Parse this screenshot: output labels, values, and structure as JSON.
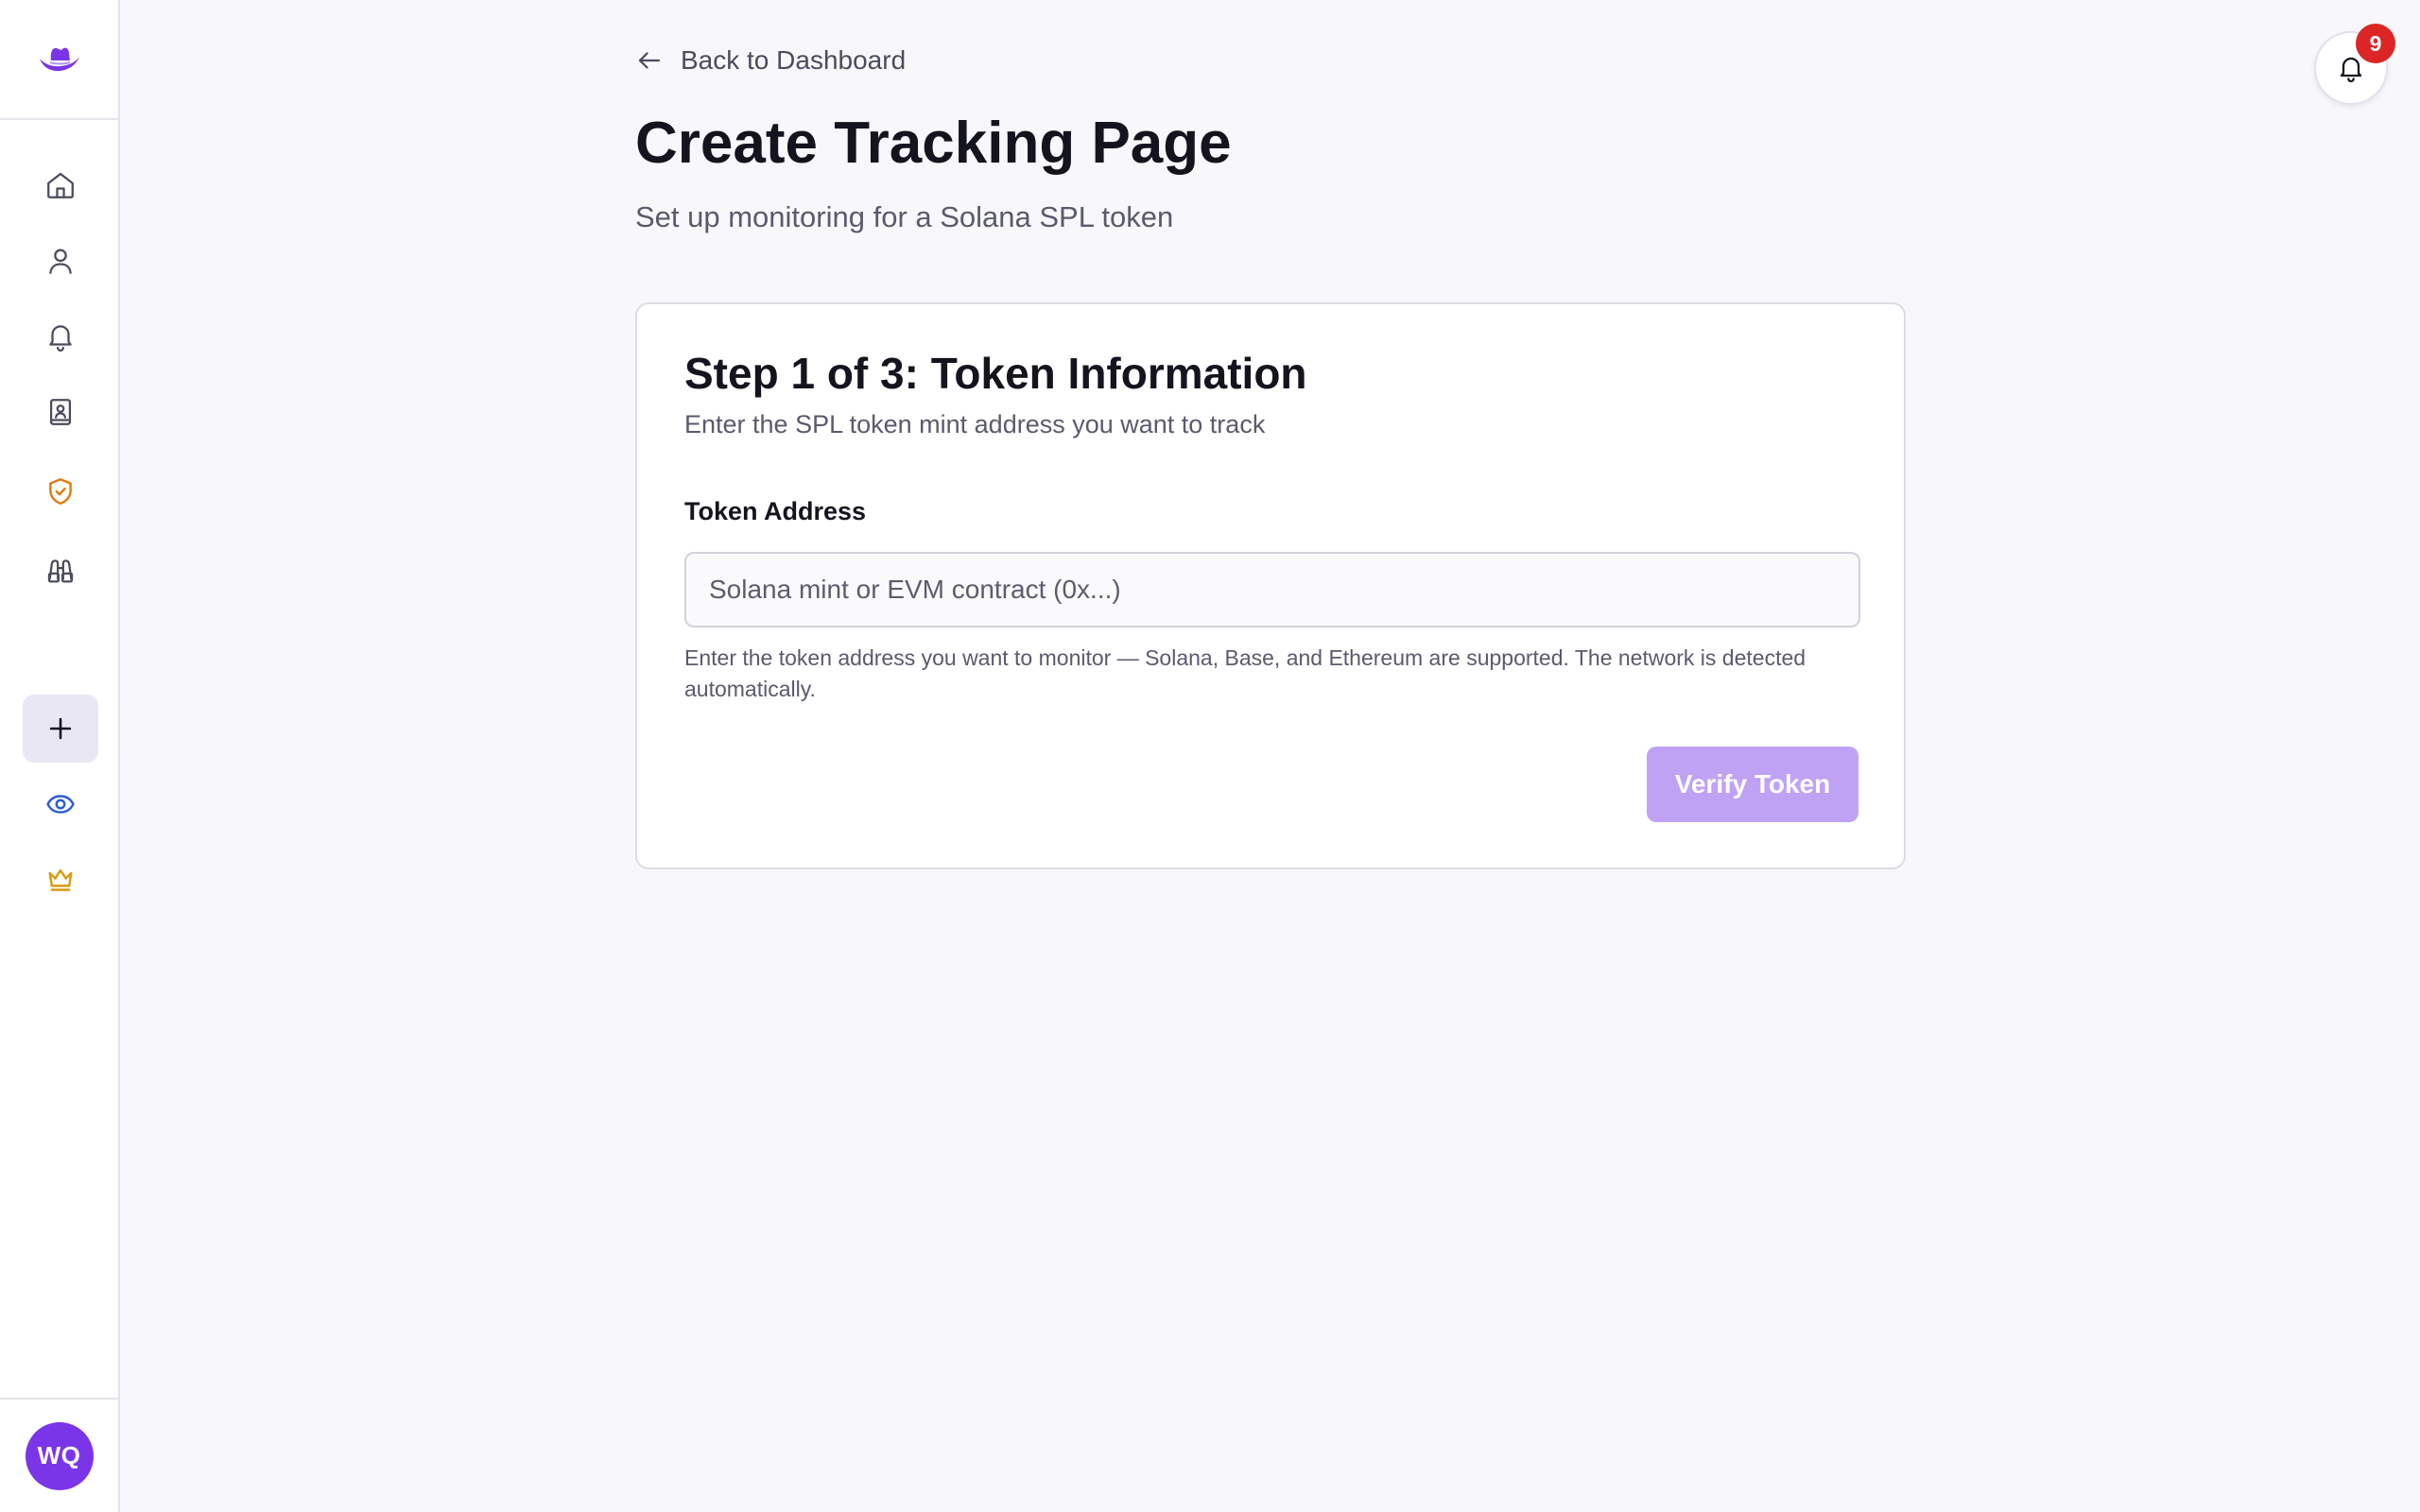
{
  "colors": {
    "accent": "#7b35e8",
    "button_disabled": "#c0a2f5",
    "badge": "#dc2626",
    "shield": "#e07a10",
    "eye": "#2b5bd6",
    "crown": "#d99a0e"
  },
  "sidebar": {
    "logo_icon": "hat-icon",
    "items": [
      {
        "icon": "home-icon"
      },
      {
        "icon": "user-icon"
      },
      {
        "icon": "bell-icon"
      },
      {
        "icon": "contact-book-icon"
      },
      {
        "icon": "shield-check-icon"
      },
      {
        "icon": "binoculars-icon"
      },
      {
        "icon": "plus-icon",
        "active": true
      },
      {
        "icon": "eye-icon"
      },
      {
        "icon": "crown-icon"
      }
    ],
    "avatar_initials": "WQ"
  },
  "header": {
    "back_label": "Back to Dashboard",
    "title": "Create Tracking Page",
    "subtitle": "Set up monitoring for a Solana SPL token"
  },
  "form": {
    "step_title": "Step 1 of 3: Token Information",
    "step_subtitle": "Enter the SPL token mint address you want to track",
    "field_label": "Token Address",
    "field_value": "",
    "field_placeholder": "Solana mint or EVM contract (0x...)",
    "help_text": "Enter the token address you want to monitor — Solana, Base, and Ethereum are supported. The network is detected automatically.",
    "submit_label": "Verify Token"
  },
  "notifications": {
    "count": "9"
  }
}
